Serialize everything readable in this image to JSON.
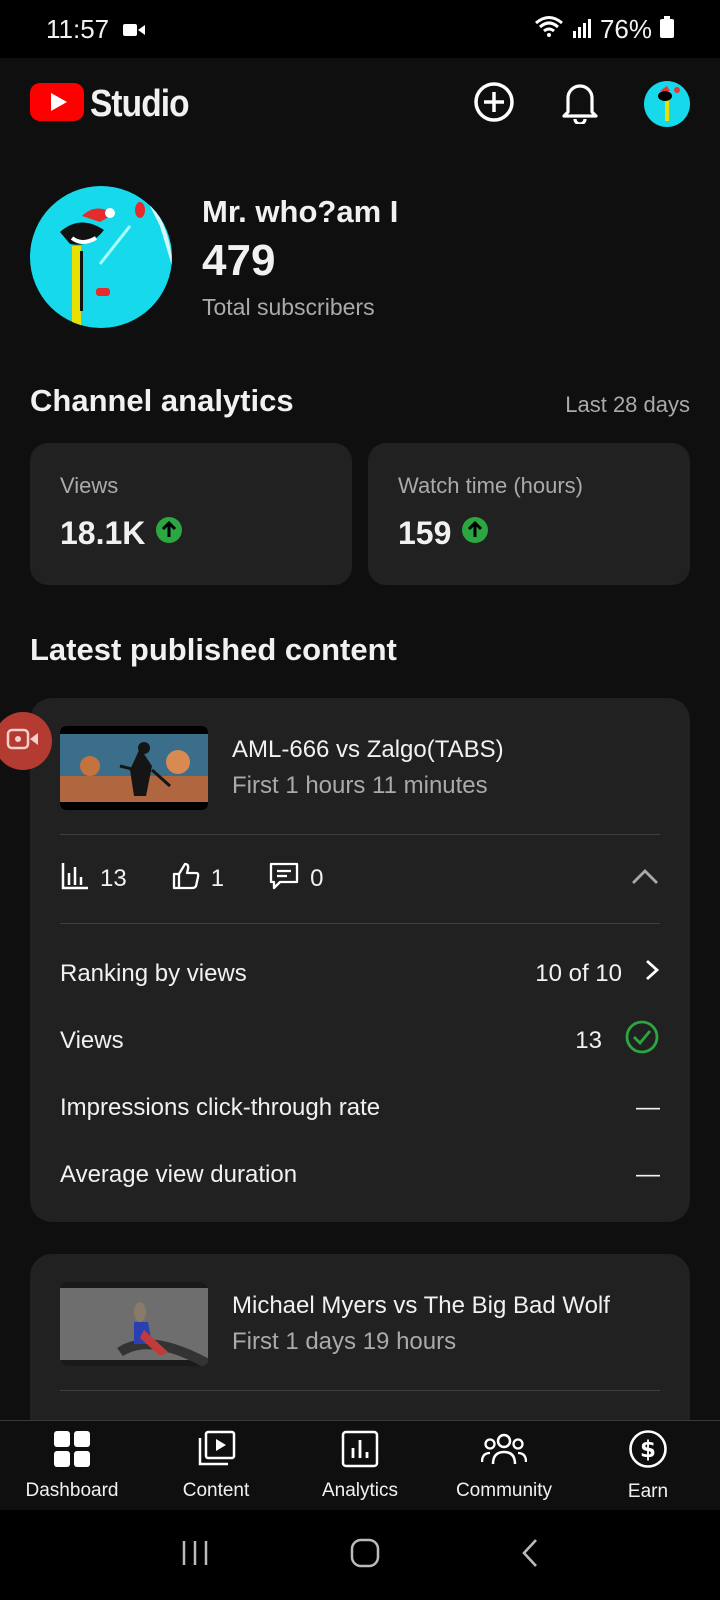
{
  "status_bar": {
    "time": "11:57",
    "battery": "76%"
  },
  "header": {
    "brand": "Studio"
  },
  "channel": {
    "name": "Mr. who?am I",
    "subscribers": "479",
    "subscribers_label": "Total subscribers"
  },
  "analytics": {
    "title": "Channel analytics",
    "period": "Last 28 days",
    "cards": [
      {
        "label": "Views",
        "value": "18.1K"
      },
      {
        "label": "Watch time (hours)",
        "value": "159"
      }
    ]
  },
  "latest": {
    "title": "Latest published content",
    "videos": [
      {
        "title": "AML-666 vs Zalgo(TABS)",
        "subtitle": "First 1 hours 11 minutes",
        "views": "13",
        "likes": "1",
        "comments": "0",
        "details": [
          {
            "label": "Ranking by views",
            "value": "10 of 10"
          },
          {
            "label": "Views",
            "value": "13"
          },
          {
            "label": "Impressions click-through rate",
            "value": "—"
          },
          {
            "label": "Average view duration",
            "value": "—"
          }
        ]
      },
      {
        "title": "Michael Myers vs The Big Bad Wolf",
        "subtitle": "First 1 days 19 hours"
      }
    ]
  },
  "nav": {
    "items": [
      "Dashboard",
      "Content",
      "Analytics",
      "Community",
      "Earn"
    ]
  },
  "colors": {
    "accent_red": "#ff0000",
    "success_green": "#2ba640",
    "avatar_cyan": "#16d9ec"
  }
}
